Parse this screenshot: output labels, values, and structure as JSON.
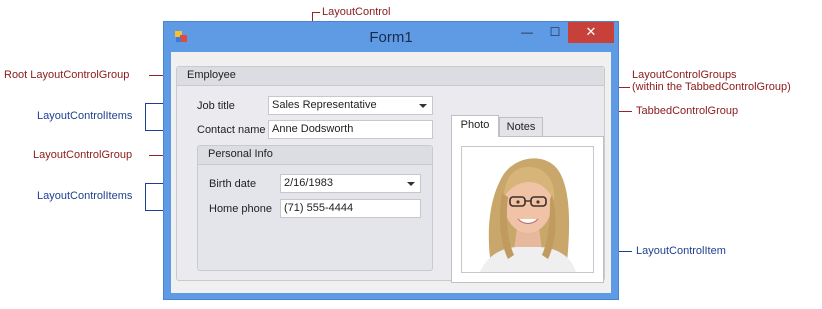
{
  "window": {
    "title": "Form1",
    "minimize_glyph": "—",
    "maximize_glyph": "☐",
    "close_glyph": "✕"
  },
  "form": {
    "employee_group_title": "Employee",
    "job_title_label": "Job title",
    "job_title_value": "Sales Representative",
    "contact_name_label": "Contact name",
    "contact_name_value": "Anne Dodsworth",
    "personal_info_group_title": "Personal Info",
    "birth_date_label": "Birth date",
    "birth_date_value": "2/16/1983",
    "home_phone_label": "Home phone",
    "home_phone_value": "(71) 555-4444",
    "tabs": [
      {
        "label": "Photo",
        "selected": true
      },
      {
        "label": "Notes",
        "selected": false
      }
    ]
  },
  "annotations": {
    "layout_control": "LayoutControl",
    "root_group": "Root LayoutControlGroup",
    "groups_in_tabbed_line1": "LayoutControlGroups",
    "groups_in_tabbed_line2": "(within the TabbedControlGroup)",
    "tabbed_control_group": "TabbedControlGroup",
    "layout_control_items_1": "LayoutControlItems",
    "layout_control_group": "LayoutControlGroup",
    "layout_control_items_2": "LayoutControlItems",
    "layout_control_item": "LayoutControlItem"
  },
  "colors": {
    "annotation_red": "#8b1a1a",
    "annotation_blue": "#1f3f8f",
    "window_frame": "#5e9be4",
    "close_button": "#c7413a"
  }
}
